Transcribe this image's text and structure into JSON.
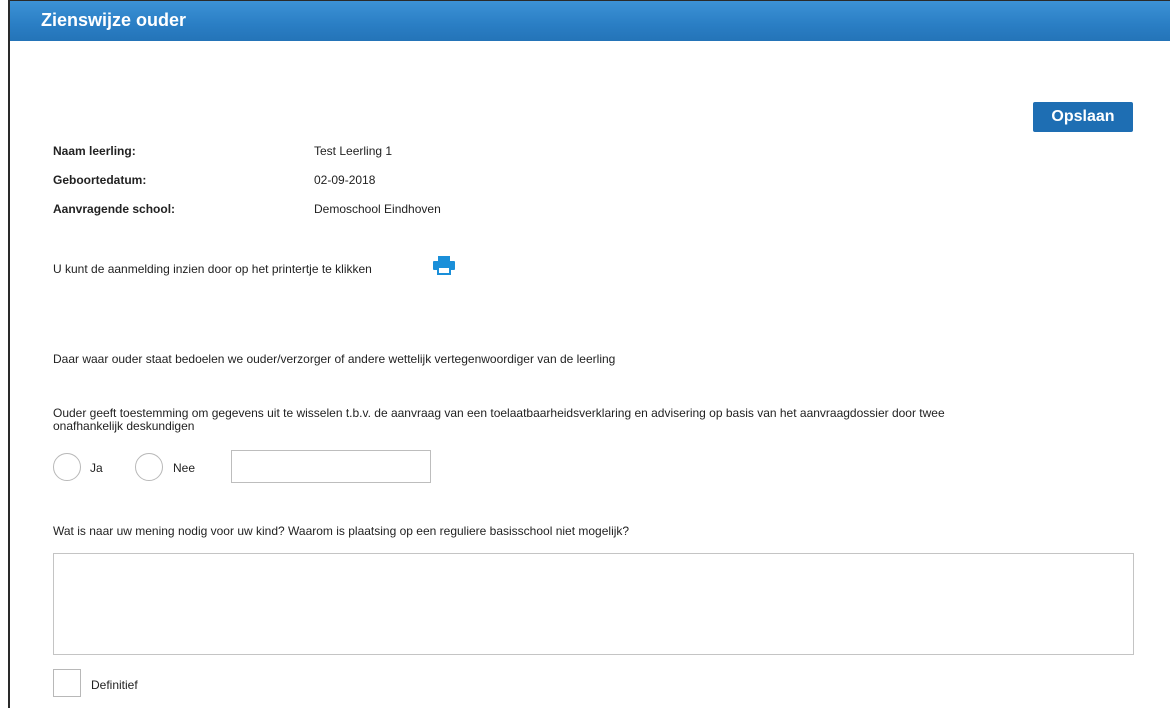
{
  "header": {
    "title": "Zienswijze ouder"
  },
  "toolbar": {
    "save_label": "Opslaan"
  },
  "student": {
    "name_label": "Naam leerling:",
    "name_value": "Test Leerling 1",
    "birthdate_label": "Geboortedatum:",
    "birthdate_value": "02-09-2018",
    "school_label": "Aanvragende school:",
    "school_value": "Demoschool Eindhoven"
  },
  "print_hint": "U kunt de aanmelding inzien door op het printertje te klikken",
  "icons": {
    "print": "printer-icon"
  },
  "notice": "Daar waar ouder staat bedoelen we ouder/verzorger of andere wettelijk vertegenwoordiger van de leerling",
  "consent": {
    "question_line1": "Ouder geeft toestemming om gegevens uit te wisselen t.b.v. de aanvraag van een toelaatbaarheidsverklaring en advisering op basis van het aanvraagdossier door twee",
    "question_line2": "onafhankelijk deskundigen",
    "option_yes": "Ja",
    "option_no": "Nee",
    "input_value": ""
  },
  "opinion": {
    "question": "Wat is naar uw mening nodig voor uw kind? Waarom is plaatsing op een reguliere basisschool niet mogelijk?",
    "value": ""
  },
  "final": {
    "label": "Definitief",
    "checked": false
  },
  "colors": {
    "header": "#2a7ec4",
    "button": "#1e6eb3",
    "icon": "#1a8fd9"
  }
}
